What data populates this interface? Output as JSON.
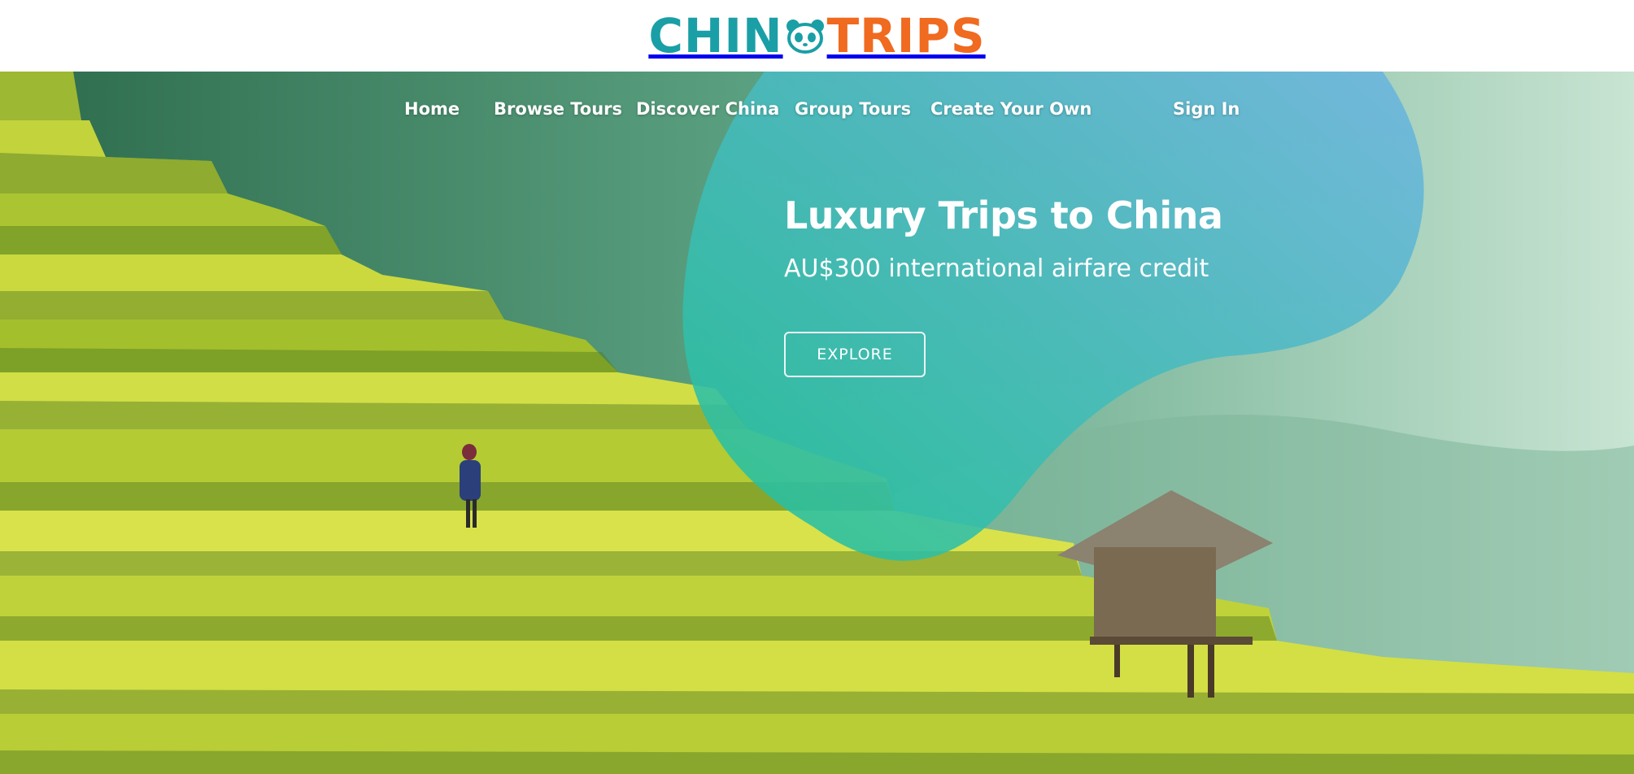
{
  "brand": {
    "logo_part1": "CHIN",
    "logo_part2": "TRIPS",
    "logo_icon": "panda-icon",
    "color_teal": "#1a9fa6",
    "color_orange": "#f06a1f"
  },
  "nav": {
    "items": [
      {
        "label": "Home"
      },
      {
        "label": "Browse Tours"
      },
      {
        "label": "Discover China"
      },
      {
        "label": "Group Tours"
      },
      {
        "label": "Create Your Own"
      }
    ],
    "sign_in": "Sign In"
  },
  "hero": {
    "title": "Luxury Trips to China",
    "subtitle": "AU$300 international airfare credit",
    "cta_label": "EXPLORE",
    "blob_gradient": [
      "#1fc29a",
      "#6cb4e0"
    ]
  }
}
